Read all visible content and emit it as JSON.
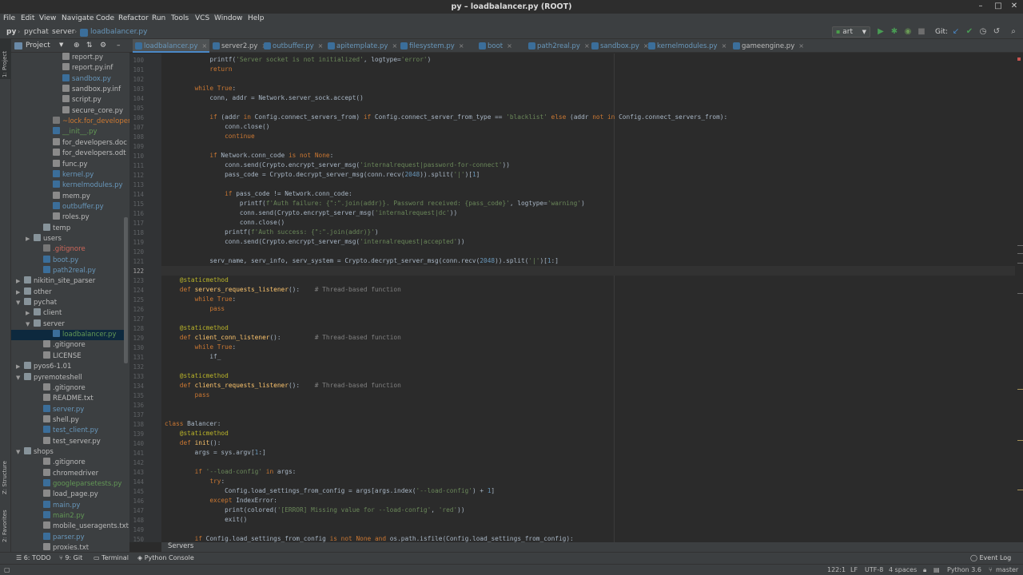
{
  "window": {
    "title": "py – loadbalancer.py (ROOT)"
  },
  "menu": [
    "File",
    "Edit",
    "View",
    "Navigate",
    "Code",
    "Refactor",
    "Run",
    "Tools",
    "VCS",
    "Window",
    "Help"
  ],
  "breadcrumb": [
    "py",
    "pychat",
    "server",
    "loadbalancer.py"
  ],
  "run_config": "art",
  "git_label": "Git:",
  "project_header": "Project",
  "tree": [
    {
      "label": "report.py",
      "indent": 5,
      "kind": "py",
      "arrow": ""
    },
    {
      "label": "report.py.inf",
      "indent": 5,
      "kind": "py",
      "arrow": ""
    },
    {
      "label": "sandbox.py",
      "indent": 5,
      "kind": "mod",
      "arrow": ""
    },
    {
      "label": "sandbox.py.inf",
      "indent": 5,
      "kind": "py",
      "arrow": ""
    },
    {
      "label": "script.py",
      "indent": 5,
      "kind": "py",
      "arrow": ""
    },
    {
      "label": "secure_core.py",
      "indent": 5,
      "kind": "py",
      "arrow": ""
    },
    {
      "label": "~lock.for_developers",
      "indent": 4,
      "kind": "ign",
      "arrow": ""
    },
    {
      "label": "__init__.py",
      "indent": 4,
      "kind": "new",
      "arrow": ""
    },
    {
      "label": "for_developers.doc",
      "indent": 4,
      "kind": "py",
      "arrow": ""
    },
    {
      "label": "for_developers.odt",
      "indent": 4,
      "kind": "py",
      "arrow": ""
    },
    {
      "label": "func.py",
      "indent": 4,
      "kind": "py",
      "arrow": ""
    },
    {
      "label": "kernel.py",
      "indent": 4,
      "kind": "mod",
      "arrow": ""
    },
    {
      "label": "kernelmodules.py",
      "indent": 4,
      "kind": "mod",
      "arrow": ""
    },
    {
      "label": "mem.py",
      "indent": 4,
      "kind": "py",
      "arrow": ""
    },
    {
      "label": "outbuffer.py",
      "indent": 4,
      "kind": "mod",
      "arrow": ""
    },
    {
      "label": "roles.py",
      "indent": 4,
      "kind": "py",
      "arrow": ""
    },
    {
      "label": "temp",
      "indent": 3,
      "kind": "dir",
      "arrow": ""
    },
    {
      "label": "users",
      "indent": 2,
      "kind": "dir",
      "arrow": "▶"
    },
    {
      "label": ".gitignore",
      "indent": 3,
      "kind": "untr",
      "arrow": ""
    },
    {
      "label": "boot.py",
      "indent": 3,
      "kind": "mod",
      "arrow": ""
    },
    {
      "label": "path2real.py",
      "indent": 3,
      "kind": "mod",
      "arrow": ""
    },
    {
      "label": "nikitin_site_parser",
      "indent": 1,
      "kind": "dir",
      "arrow": "▶"
    },
    {
      "label": "other",
      "indent": 1,
      "kind": "dir",
      "arrow": "▶"
    },
    {
      "label": "pychat",
      "indent": 1,
      "kind": "dir",
      "arrow": "▼"
    },
    {
      "label": "client",
      "indent": 2,
      "kind": "dir",
      "arrow": "▶"
    },
    {
      "label": "server",
      "indent": 2,
      "kind": "dir",
      "arrow": "▼"
    },
    {
      "label": "loadbalancer.py",
      "indent": 4,
      "kind": "new",
      "arrow": ""
    },
    {
      "label": ".gitignore",
      "indent": 3,
      "kind": "py",
      "arrow": ""
    },
    {
      "label": "LICENSE",
      "indent": 3,
      "kind": "py",
      "arrow": ""
    },
    {
      "label": "pyos6-1.01",
      "indent": 1,
      "kind": "dir",
      "arrow": "▶"
    },
    {
      "label": "pyremoteshell",
      "indent": 1,
      "kind": "dir",
      "arrow": "▼"
    },
    {
      "label": ".gitignore",
      "indent": 3,
      "kind": "py",
      "arrow": ""
    },
    {
      "label": "README.txt",
      "indent": 3,
      "kind": "py",
      "arrow": ""
    },
    {
      "label": "server.py",
      "indent": 3,
      "kind": "mod",
      "arrow": ""
    },
    {
      "label": "shell.py",
      "indent": 3,
      "kind": "py",
      "arrow": ""
    },
    {
      "label": "test_client.py",
      "indent": 3,
      "kind": "mod",
      "arrow": ""
    },
    {
      "label": "test_server.py",
      "indent": 3,
      "kind": "py",
      "arrow": ""
    },
    {
      "label": "shops",
      "indent": 1,
      "kind": "dir",
      "arrow": "▼"
    },
    {
      "label": ".gitignore",
      "indent": 3,
      "kind": "py",
      "arrow": ""
    },
    {
      "label": "chromedriver",
      "indent": 3,
      "kind": "py",
      "arrow": ""
    },
    {
      "label": "googleparsetests.py",
      "indent": 3,
      "kind": "new",
      "arrow": ""
    },
    {
      "label": "load_page.py",
      "indent": 3,
      "kind": "py",
      "arrow": ""
    },
    {
      "label": "main.py",
      "indent": 3,
      "kind": "mod",
      "arrow": ""
    },
    {
      "label": "main2.py",
      "indent": 3,
      "kind": "new",
      "arrow": ""
    },
    {
      "label": "mobile_useragents.txt",
      "indent": 3,
      "kind": "py",
      "arrow": ""
    },
    {
      "label": "parser.py",
      "indent": 3,
      "kind": "mod",
      "arrow": ""
    },
    {
      "label": "proxies.txt",
      "indent": 3,
      "kind": "py",
      "arrow": ""
    }
  ],
  "tabs": [
    "loadbalancer.py",
    "server2.py",
    "outbuffer.py",
    "apitemplate.py",
    "filesystem.py",
    "boot",
    "path2real.py",
    "sandbox.py",
    "kernelmodules.py",
    "gameengine.py"
  ],
  "active_tab": 0,
  "code_start_line": 100,
  "current_line": 122,
  "code": [
    "            printf('Server socket is not initialized', logtype='error')",
    "            return",
    "",
    "        while True:",
    "            conn, addr = Network.server_sock.accept()",
    "",
    "            if (addr in Config.connect_servers_from) if Config.connect_server_from_type == 'blacklist' else (addr not in Config.connect_servers_from):",
    "                conn.close()",
    "                continue",
    "",
    "            if Network.conn_code is not None:",
    "                conn.send(Crypto.encrypt_server_msg('internalrequest|password-for-connect'))",
    "                pass_code = Crypto.decrypt_server_msg(conn.recv(2048)).split('|')[1]",
    "",
    "                if pass_code != Network.conn_code:",
    "                    printf(f'Auth failure: {\":\".join(addr)}. Password received: {pass_code}', logtype='warning')",
    "                    conn.send(Crypto.encrypt_server_msg('internalrequest|dc'))",
    "                    conn.close()",
    "                printf(f'Auth success: {\":\".join(addr)}')",
    "                conn.send(Crypto.encrypt_server_msg('internalrequest|accepted'))",
    "",
    "            serv_name, serv_info, serv_system = Crypto.decrypt_server_msg(conn.recv(2048)).split('|')[1:]",
    "",
    "    @staticmethod",
    "    def servers_requests_listener():    # Thread-based function",
    "        while True:",
    "            pass",
    "",
    "    @staticmethod",
    "    def client_conn_listener():         # Thread-based function",
    "        while True:",
    "            if_",
    "",
    "    @staticmethod",
    "    def clients_requests_listener():    # Thread-based function",
    "        pass",
    "",
    "",
    "class Balancer:",
    "    @staticmethod",
    "    def init():",
    "        args = sys.argv[1:]",
    "",
    "        if '--load-config' in args:",
    "            try:",
    "                Config.load_settings_from_config = args[args.index('--load-config') + 1]",
    "            except IndexError:",
    "                print(colored('[ERROR] Missing value for --load-config', 'red'))",
    "                exit()",
    "",
    "        if Config.load_settings_from_config is not None and os.path.isfile(Config.load_settings_from_config):"
  ],
  "bottom_panel_title": "Servers",
  "tool_windows": [
    "6: TODO",
    "9: Git",
    "Terminal",
    "Python Console"
  ],
  "event_log": "Event Log",
  "side_tabs": {
    "project": "1: Project",
    "structure": "Z: Structure",
    "favorites": "2: Favorites"
  },
  "status": {
    "position": "122:1",
    "line_sep": "LF",
    "encoding": "UTF-8",
    "indent": "4 spaces",
    "interpreter": "Python 3.6",
    "branch": "master"
  },
  "colors": {
    "background": "#2b2b2b",
    "panel": "#3c3f41",
    "keyword": "#cc7832",
    "string": "#6a8759",
    "decorator": "#bbb529",
    "function": "#ffc66d",
    "comment": "#808080",
    "modified": "#6897bb",
    "added": "#629755"
  }
}
